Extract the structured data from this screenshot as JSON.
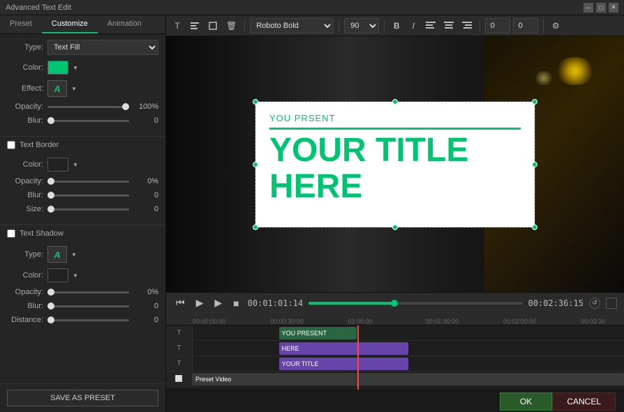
{
  "app": {
    "title": "Advanced Text Edit",
    "title_btn_minimize": "─",
    "title_btn_maximize": "□",
    "title_btn_close": "✕"
  },
  "tabs": {
    "preset": "Preset",
    "customize": "Customize",
    "animation": "Animation"
  },
  "left_panel": {
    "type_label": "Type:",
    "type_value": "Text Fill",
    "color_label": "Color:",
    "effect_label": "Effect:",
    "opacity_label": "Opacity:",
    "opacity_value": "100%",
    "blur_label": "Blur:",
    "blur_value": "0",
    "text_border_label": "Text Border",
    "border_color_label": "Color:",
    "border_opacity_label": "Opacity:",
    "border_opacity_value": "0%",
    "border_blur_label": "Blur:",
    "border_blur_value": "0",
    "border_size_label": "Size:",
    "border_size_value": "0",
    "text_shadow_label": "Text Shadow",
    "shadow_type_label": "Type:",
    "shadow_color_label": "Color:",
    "shadow_opacity_label": "Opacity:",
    "shadow_opacity_value": "0%",
    "shadow_blur_label": "Blur:",
    "shadow_blur_value": "0",
    "shadow_distance_label": "Distance:",
    "shadow_distance_value": "0",
    "save_preset_label": "SAVE AS PRESET"
  },
  "toolbar": {
    "font_name": "Roboto Bold",
    "font_size": "90",
    "bold_icon": "B",
    "italic_icon": "I",
    "align_left": "≡",
    "align_center": "≡",
    "align_right": "≡",
    "number1_value": "0",
    "number2_value": "0"
  },
  "preview": {
    "subtitle_text": "YOU PRSENT",
    "main_text_line1": "YOUR TITLE",
    "main_text_line2": "HERE"
  },
  "transport": {
    "time_current": "00:01:01:14",
    "time_total": "00:02:36:15"
  },
  "timeline": {
    "rulers": [
      "00:00:00:00",
      "00:00:30:00",
      "01:00:00",
      "00:01:30:00",
      "00:02:00:00",
      "00:02:30"
    ],
    "tracks": [
      {
        "icon": "T",
        "clips": [
          {
            "label": "YOU PRESENT",
            "start_pct": 20,
            "width_pct": 20,
            "style": "text"
          }
        ]
      },
      {
        "icon": "T",
        "clips": [
          {
            "label": "HERE",
            "start_pct": 20,
            "width_pct": 30,
            "style": "text2"
          }
        ]
      },
      {
        "icon": "T",
        "clips": [
          {
            "label": "YOUR TITLE",
            "start_pct": 20,
            "width_pct": 30,
            "style": "text2"
          }
        ]
      },
      {
        "icon": "□",
        "clips": [
          {
            "label": "Preset Video",
            "start_pct": 20,
            "width_pct": 70,
            "style": "video"
          }
        ]
      }
    ]
  },
  "actions": {
    "ok_label": "OK",
    "cancel_label": "CANCEL"
  }
}
